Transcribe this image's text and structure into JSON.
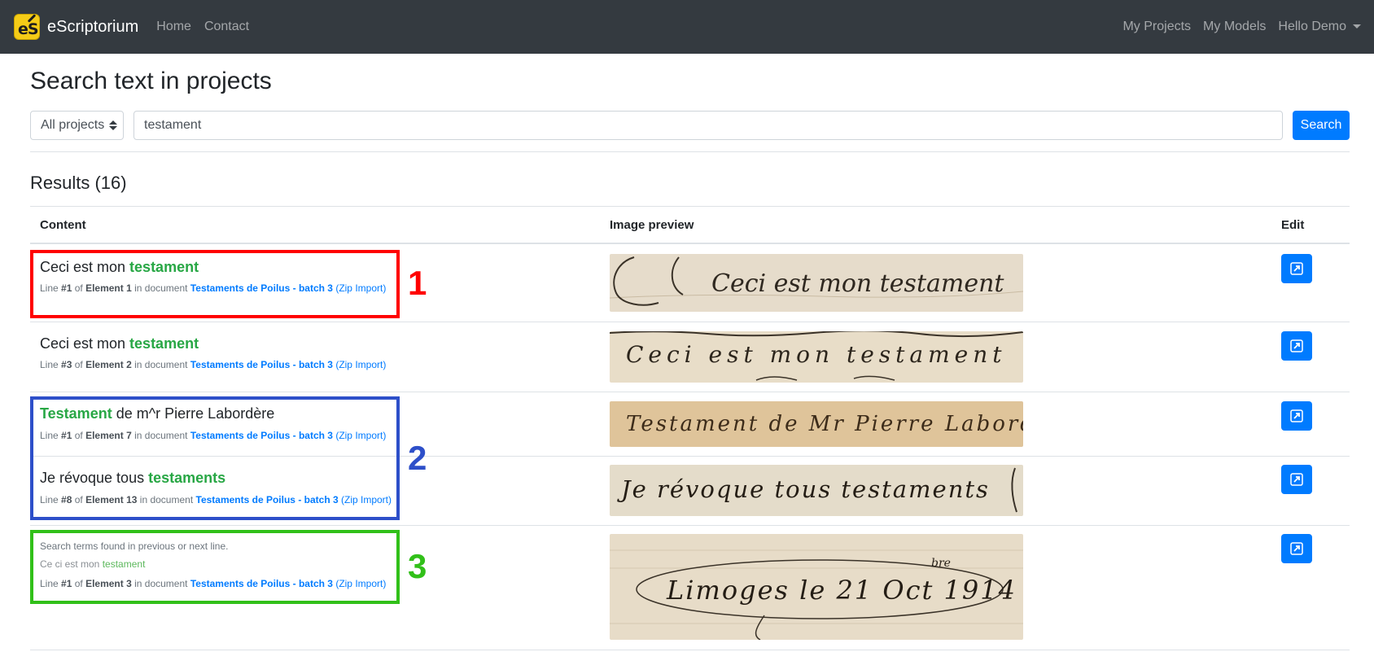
{
  "nav": {
    "brand": "eScriptorium",
    "links": [
      "Home",
      "Contact"
    ],
    "right_links": [
      "My Projects",
      "My Models"
    ],
    "user_menu": "Hello Demo"
  },
  "search": {
    "title": "Search text in projects",
    "project_select": "All projects",
    "query": "testament",
    "button": "Search"
  },
  "results": {
    "title": "Results (16)",
    "headers": {
      "content": "Content",
      "preview": "Image preview",
      "edit": "Edit"
    },
    "rows": [
      {
        "pre": "Ceci est mon ",
        "match": "testament",
        "post": "",
        "line_label": "Line ",
        "line": "#1",
        "of": " of ",
        "element": "Element 1",
        "in_doc": " in document ",
        "document": "Testaments de Poilus - batch 3",
        "import": " (Zip Import)",
        "preview_text": "Ceci est mon testament"
      },
      {
        "pre": "Ceci est mon ",
        "match": "testament",
        "post": "",
        "line_label": "Line ",
        "line": "#3",
        "of": " of ",
        "element": "Element 2",
        "in_doc": " in document ",
        "document": "Testaments de Poilus - batch 3",
        "import": " (Zip Import)",
        "preview_text": "Ceci est mon testament"
      },
      {
        "pre": "",
        "match": "Testament",
        "post": " de m^r Pierre Labordère",
        "line_label": "Line ",
        "line": "#1",
        "of": " of ",
        "element": "Element 7",
        "in_doc": " in document ",
        "document": "Testaments de Poilus - batch 3",
        "import": " (Zip Import)",
        "preview_text": "Testament de Mr Pierre Labordère"
      },
      {
        "pre": "Je révoque tous ",
        "match": "testaments",
        "post": "",
        "line_label": "Line ",
        "line": "#8",
        "of": " of ",
        "element": "Element 13",
        "in_doc": " in document ",
        "document": "Testaments de Poilus - batch 3",
        "import": " (Zip Import)",
        "preview_text": "Je révoque tous testaments"
      },
      {
        "note": "Search terms found in previous or next line.",
        "context_pre": "Ce ci est mon ",
        "context_match": "testament",
        "line_label": "Line ",
        "line": "#1",
        "of": " of ",
        "element": "Element 3",
        "in_doc": " in document ",
        "document": "Testaments de Poilus - batch 3",
        "import": " (Zip Import)",
        "preview_text": "Limoges le 21 Oct 1914",
        "preview_superscript": "bre"
      }
    ]
  },
  "annotations": [
    "1",
    "2",
    "3"
  ],
  "colors": {
    "navbar": "#343a40",
    "primary": "#007bff",
    "highlight": "#28a745",
    "annotation_red": "#ff0000",
    "annotation_blue": "#2d4fc9",
    "annotation_green": "#31c019"
  },
  "icons": [
    "escriptorium-logo-icon",
    "caret-down-icon",
    "select-arrows-icon",
    "external-link-icon"
  ]
}
